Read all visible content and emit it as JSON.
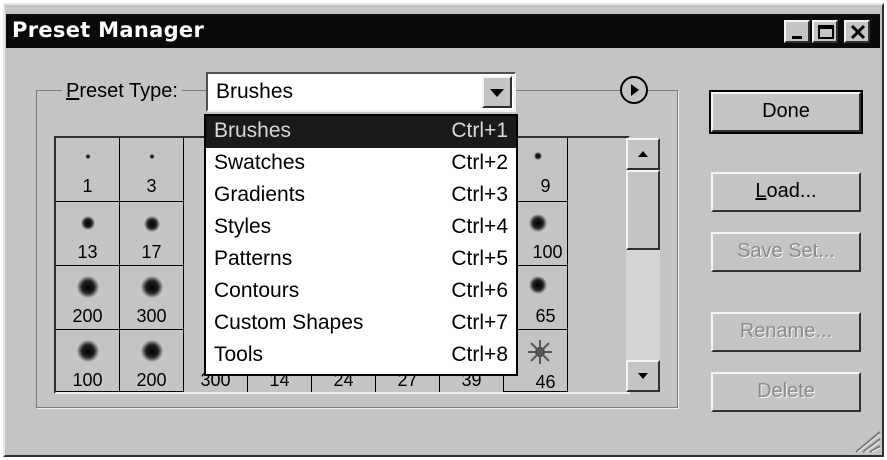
{
  "window": {
    "title": "Preset Manager"
  },
  "titlebar_buttons": {
    "minimize": "minimize-icon",
    "maximize": "maximize-icon",
    "close": "close-icon"
  },
  "preset_type": {
    "label_first": "P",
    "label_rest": "reset Type:",
    "selected": "Brushes"
  },
  "menu_button_icon": "right-arrow-circle-icon",
  "dropdown": {
    "items": [
      {
        "label": "Brushes",
        "shortcut": "Ctrl+1",
        "selected": true
      },
      {
        "label": "Swatches",
        "shortcut": "Ctrl+2"
      },
      {
        "label": "Gradients",
        "shortcut": "Ctrl+3"
      },
      {
        "label": "Styles",
        "shortcut": "Ctrl+4"
      },
      {
        "label": "Patterns",
        "shortcut": "Ctrl+5"
      },
      {
        "label": "Contours",
        "shortcut": "Ctrl+6"
      },
      {
        "label": "Custom Shapes",
        "shortcut": "Ctrl+7"
      },
      {
        "label": "Tools",
        "shortcut": "Ctrl+8"
      }
    ]
  },
  "brushes": {
    "left_columns": [
      [
        "1",
        "13",
        "200",
        "100"
      ],
      [
        "3",
        "17",
        "300",
        "200"
      ]
    ],
    "right_column": [
      "9",
      "100",
      "65",
      "46"
    ],
    "bottom_row_partial": [
      "300",
      "14",
      "24",
      "27",
      "39"
    ]
  },
  "buttons": {
    "done": "Done",
    "load_first": "L",
    "load_rest": "oad...",
    "save_set": "Save Set...",
    "rename": "Rename...",
    "delete": "Delete"
  }
}
